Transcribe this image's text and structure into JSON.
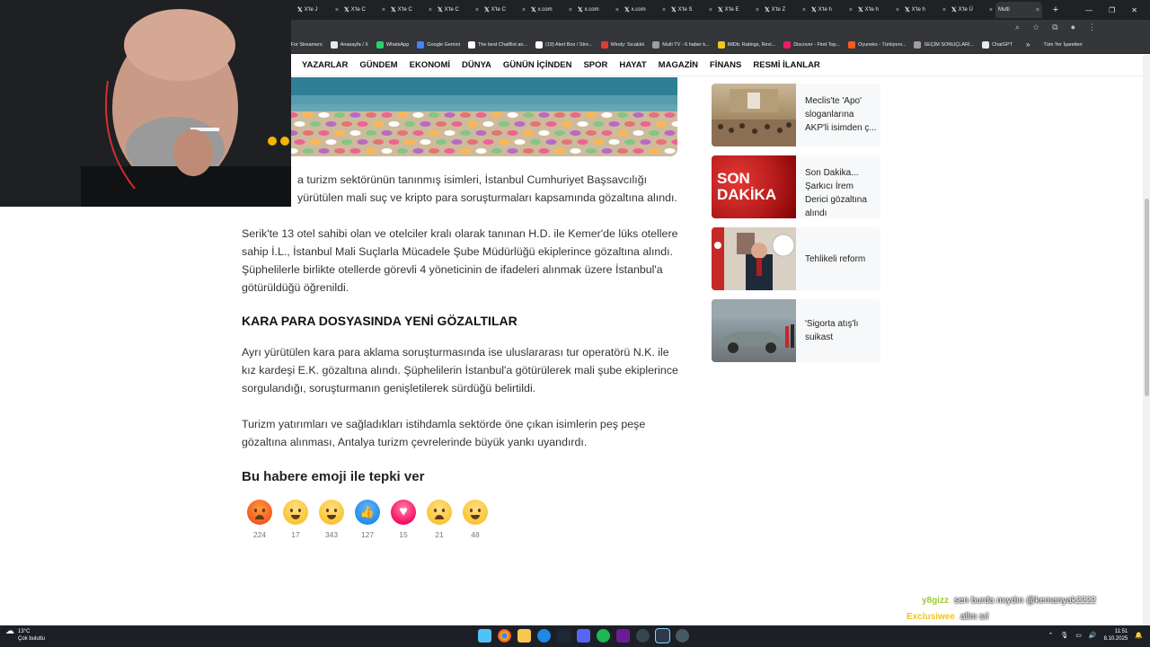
{
  "browser": {
    "tabs": [
      {
        "label": "X'te J"
      },
      {
        "label": "X'te C"
      },
      {
        "label": "X'te C"
      },
      {
        "label": "X'te C"
      },
      {
        "label": "X'te C"
      },
      {
        "label": "x.com"
      },
      {
        "label": "x.com"
      },
      {
        "label": "x.com"
      },
      {
        "label": "X'te S"
      },
      {
        "label": "X'te E"
      },
      {
        "label": "X'te Z"
      },
      {
        "label": "X'te h"
      },
      {
        "label": "X'te h"
      },
      {
        "label": "X'te h"
      },
      {
        "label": "X'te Ü"
      },
      {
        "label": "Multi",
        "active": true
      }
    ],
    "bookmarks": [
      {
        "label": "d For Streamers",
        "color": "#6441a5"
      },
      {
        "label": "Anasayfa / X",
        "color": "#e8eaed"
      },
      {
        "label": "WhatsApp",
        "color": "#25d366"
      },
      {
        "label": "Google Gemini",
        "color": "#4285f4"
      },
      {
        "label": "The best ChatBot an...",
        "color": "#ffffff"
      },
      {
        "label": "(19) Alert Box / Stre...",
        "color": "#ffffff"
      },
      {
        "label": "Windy: Sıcaklık",
        "color": "#e53935"
      },
      {
        "label": "Multi TV - 6 haber k...",
        "color": "#9e9e9e"
      },
      {
        "label": "IMDb: Ratings, Revi...",
        "color": "#f5c518"
      },
      {
        "label": "Discover - Find Top...",
        "color": "#e91e63"
      },
      {
        "label": "Oyuneks - Türkiyeni...",
        "color": "#ff5722"
      },
      {
        "label": "SEÇİM SONUÇLARI...",
        "color": "#9e9e9e"
      },
      {
        "label": "ChatGPT",
        "color": "#e8eaed"
      }
    ],
    "all_bookmarks": "Tüm Yer İşaretleri"
  },
  "nav": {
    "items": [
      "YAZARLAR",
      "GÜNDEM",
      "EKONOMİ",
      "DÜNYA",
      "GÜNÜN İÇİNDEN",
      "SPOR",
      "HAYAT",
      "MAGAZİN",
      "FİNANS",
      "RESMİ İLANLAR"
    ]
  },
  "article": {
    "p1a": "a turizm sektörünün tanınmış isimleri, İstanbul Cumhuriyet Başsavcılığı",
    "p1b": "yürütülen mali suç ve kripto para soruşturmaları kapsamında gözaltına alındı.",
    "p2": "Serik'te 13 otel sahibi olan ve otelciler kralı olarak tanınan H.D. ile Kemer'de lüks otellere sahip İ.L., İstanbul Mali Suçlarla Mücadele Şube Müdürlüğü ekiplerince gözaltına alındı. Şüphelilerle birlikte otellerde görevli 4 yöneticinin de ifadeleri alınmak üzere İstanbul'a götürüldüğü öğrenildi.",
    "h2": "KARA PARA DOSYASINDA YENİ GÖZALTILAR",
    "p3": "Ayrı yürütülen kara para aklama soruşturmasında ise uluslararası tur operatörü N.K. ile kız kardeşi E.K. gözaltına alındı. Şüphelilerin İstanbul'a götürülerek mali şube ekiplerince sorgulandığı, soruşturmanın genişletilerek sürdüğü belirtildi.",
    "p4": "Turizm yatırımları ve sağladıkları istihdamla sektörde öne çıkan isimlerin peş peşe gözaltına alınması, Antalya turizm çevrelerinde büyük yankı uyandırdı."
  },
  "reactions": {
    "title": "Bu habere emoji ile tepki ver",
    "items": [
      {
        "emoji": "angry",
        "count": "224"
      },
      {
        "emoji": "heart-eyes",
        "count": "17"
      },
      {
        "emoji": "laughing",
        "count": "343"
      },
      {
        "emoji": "thumbs-up",
        "count": "127"
      },
      {
        "emoji": "heart",
        "count": "15"
      },
      {
        "emoji": "sad",
        "count": "21"
      },
      {
        "emoji": "surprised",
        "count": "48"
      }
    ]
  },
  "sidebar": [
    {
      "title": "Meclis'te 'Apo' sloganlarına AKP'li isimden ç..."
    },
    {
      "title": "Son Dakika... Şarkıcı İrem Derici gözaltına alındı",
      "thumb_text_1": "SON",
      "thumb_text_2": "DAKİKA"
    },
    {
      "title": "Tehlikeli reform"
    },
    {
      "title": "'Sigorta atış'lı suikast"
    }
  ],
  "chat": [
    {
      "user": "y8gizz",
      "message": "sen burda mıydın @kemanyak2222"
    },
    {
      "user": "Exclusiwee",
      "message": "allm sıl"
    },
    {
      "user": "y8gizz",
      "message": ""
    }
  ],
  "taskbar": {
    "temp": "13°C",
    "weather": "Çok bulutlu",
    "time": "11:51",
    "date": "8.10.2025"
  },
  "colors": {
    "chat_user": "#9acd32",
    "taskbar_bg": "#1c1f26",
    "son_dakika_red": "#c8102e"
  }
}
